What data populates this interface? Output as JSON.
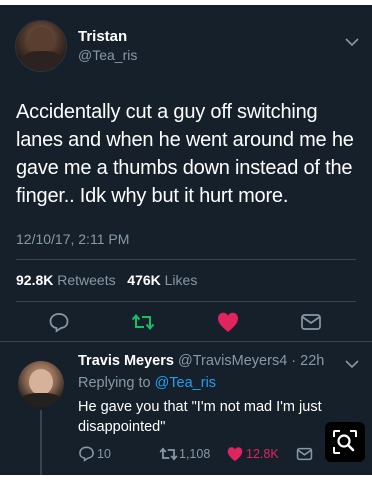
{
  "tweet": {
    "author_name": "Tristan",
    "author_handle": "@Tea_ris",
    "text": "Accidentally cut a guy off switching lanes and when he went around me he gave me a thumbs down instead of the finger.. Idk why but it hurt more.",
    "timestamp": "12/10/17, 2:11 PM",
    "retweets_count": "92.8K",
    "retweets_label": "Retweets",
    "likes_count": "476K",
    "likes_label": "Likes",
    "actions": [
      "reply-icon",
      "retweet-icon",
      "like-icon",
      "share-icon"
    ],
    "colors": {
      "retweet": "#17bf63",
      "like": "#e0245e",
      "icon": "#8899a6"
    }
  },
  "reply": {
    "author_name": "Travis Meyers",
    "author_handle_time": "@TravisMeyers4 · 22h",
    "replying_prefix": "Replying to",
    "replying_handle": "@Tea_ris",
    "text": "He gave you that \"I'm not mad I'm just disappointed\"",
    "reply_count": "10",
    "retweet_count": "1,108",
    "like_count": "12.8K"
  },
  "theme": {
    "background": "#15202b",
    "text": "#ffffff",
    "muted": "#8899a6",
    "link": "#1da1f2",
    "divider": "#38444d"
  }
}
